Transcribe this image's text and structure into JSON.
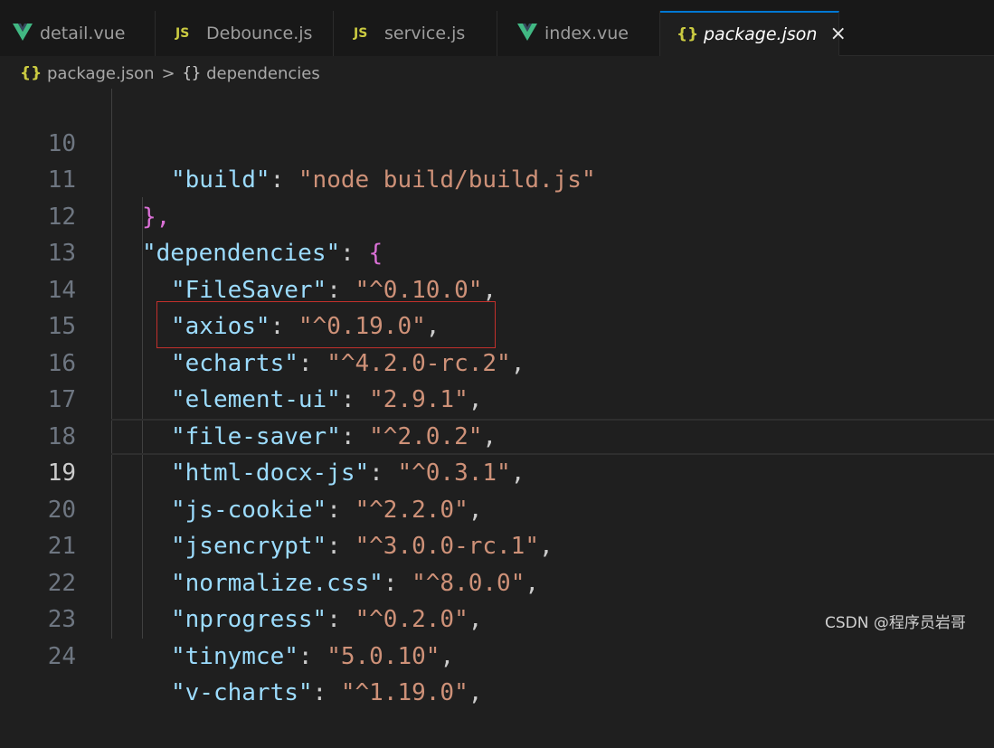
{
  "tabs": [
    {
      "label": "detail.vue",
      "icon": "vue-icon",
      "active": false
    },
    {
      "label": "Debounce.js",
      "icon": "js-icon",
      "active": false
    },
    {
      "label": "service.js",
      "icon": "js-icon",
      "active": false
    },
    {
      "label": "index.vue",
      "icon": "vue-icon",
      "active": false
    },
    {
      "label": "package.json",
      "icon": "json-icon",
      "active": true
    }
  ],
  "icon_text": {
    "js": "JS",
    "json": "{}",
    "close": "×"
  },
  "breadcrumb": {
    "file": "package.json",
    "separator": ">",
    "braces": "{}",
    "section": "dependencies"
  },
  "lines": [
    {
      "n": "10",
      "key": "\"build\"",
      "sep": ": ",
      "val": "\"node build/build.js\"",
      "end": ""
    },
    {
      "n": "11",
      "text": "},"
    },
    {
      "n": "12",
      "key": "\"dependencies\"",
      "sep": ": ",
      "open": "{"
    },
    {
      "n": "13",
      "key": "\"FileSaver\"",
      "sep": ": ",
      "val": "\"^0.10.0\"",
      "end": ","
    },
    {
      "n": "14",
      "key": "\"axios\"",
      "sep": ": ",
      "val": "\"^0.19.0\"",
      "end": ","
    },
    {
      "n": "15",
      "key": "\"echarts\"",
      "sep": ": ",
      "val": "\"^4.2.0-rc.2\"",
      "end": ","
    },
    {
      "n": "16",
      "key": "\"element-ui\"",
      "sep": ": ",
      "val": "\"2.9.1\"",
      "end": ","
    },
    {
      "n": "17",
      "key": "\"file-saver\"",
      "sep": ": ",
      "val": "\"^2.0.2\"",
      "end": ","
    },
    {
      "n": "18",
      "key": "\"html-docx-js\"",
      "sep": ": ",
      "val": "\"^0.3.1\"",
      "end": ","
    },
    {
      "n": "19",
      "key": "\"js-cookie\"",
      "sep": ": ",
      "val": "\"^2.2.0\"",
      "end": ","
    },
    {
      "n": "20",
      "key": "\"jsencrypt\"",
      "sep": ": ",
      "val": "\"^3.0.0-rc.1\"",
      "end": ","
    },
    {
      "n": "21",
      "key": "\"normalize.css\"",
      "sep": ": ",
      "val": "\"^8.0.0\"",
      "end": ","
    },
    {
      "n": "22",
      "key": "\"nprogress\"",
      "sep": ": ",
      "val": "\"^0.2.0\"",
      "end": ","
    },
    {
      "n": "23",
      "key": "\"tinymce\"",
      "sep": ": ",
      "val": "\"5.0.10\"",
      "end": ","
    },
    {
      "n": "24",
      "key": "\"v-charts\"",
      "sep": ": ",
      "val": "\"^1.19.0\"",
      "end": ","
    }
  ],
  "current_line": "19",
  "highlighted_line": "16",
  "watermark": "CSDN @程序员岩哥",
  "colors": {
    "accent": "#0078d4",
    "key": "#9cdcfe",
    "string": "#ce9178",
    "bracket": "#da70d6",
    "highlight_box": "#c2302c",
    "vue_green": "#41b883",
    "js_yellow": "#cbcb41"
  }
}
